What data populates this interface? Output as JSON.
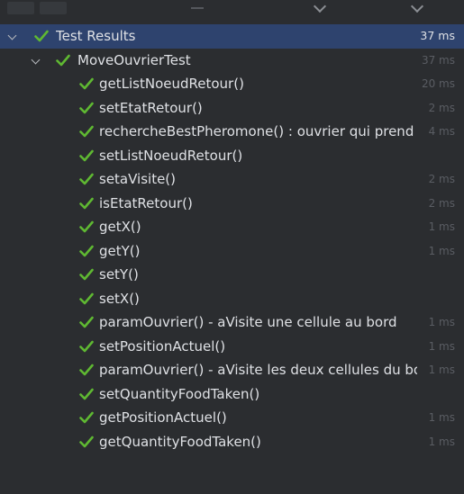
{
  "colors": {
    "background": "#2b2d30",
    "selected_row": "#2e436e",
    "pass_check": "#5fb832",
    "text": "#dfe1e5",
    "muted_time": "#5a5d63"
  },
  "root": {
    "name": "Test Results",
    "time": "37 ms",
    "status_icon": "check-icon"
  },
  "suite": {
    "name": "MoveOuvrierTest",
    "time": "37 ms",
    "status_icon": "check-icon"
  },
  "tests": [
    {
      "name": "getListNoeudRetour()",
      "time": "20 ms"
    },
    {
      "name": "setEtatRetour()",
      "time": "2 ms"
    },
    {
      "name": "rechercheBestPheromone() : ouvrier qui prend la",
      "time": "4 ms"
    },
    {
      "name": "setListNoeudRetour()",
      "time": ""
    },
    {
      "name": "setaVisite()",
      "time": "2 ms"
    },
    {
      "name": "isEtatRetour()",
      "time": "2 ms"
    },
    {
      "name": "getX()",
      "time": "1 ms"
    },
    {
      "name": "getY()",
      "time": "1 ms"
    },
    {
      "name": "setY()",
      "time": ""
    },
    {
      "name": "setX()",
      "time": ""
    },
    {
      "name": "paramOuvrier() - aVisite une cellule au bord",
      "time": "1 ms"
    },
    {
      "name": "setPositionActuel()",
      "time": "1 ms"
    },
    {
      "name": "paramOuvrier() - aVisite les deux cellules du bord",
      "time": "1 ms"
    },
    {
      "name": "setQuantityFoodTaken()",
      "time": ""
    },
    {
      "name": "getPositionActuel()",
      "time": "1 ms"
    },
    {
      "name": "getQuantityFoodTaken()",
      "time": "1 ms"
    }
  ]
}
